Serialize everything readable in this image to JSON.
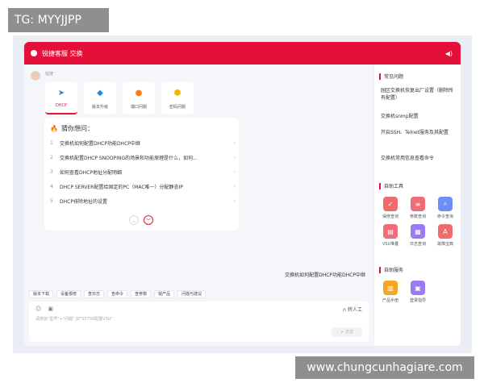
{
  "overlay_tag": "TG: MYYJJPP",
  "watermark": "www.chungcunhagiare.com",
  "titlebar": {
    "title": "锐捷客服 交换"
  },
  "bot": {
    "name": "锐捷"
  },
  "quick_cards": [
    {
      "label": "DHCP",
      "icon": "navigation-icon",
      "color": "#3a7bd5"
    },
    {
      "label": "版本升级",
      "icon": "upgrade-icon",
      "color": "#1e88e5"
    },
    {
      "label": "端口问题",
      "icon": "port-icon",
      "color": "#ff7a1a"
    },
    {
      "label": "密码问题",
      "icon": "password-icon",
      "color": "#f5b400"
    }
  ],
  "guess": {
    "title": "猜你想问：",
    "items": [
      {
        "num": "1",
        "text": "交换机如何配置DHCP功能DHCP中继"
      },
      {
        "num": "2",
        "text": "交换机配置DHCP SNOOPING的场景和功能原理是什么，如何..."
      },
      {
        "num": "3",
        "text": "如何查看DHCP地址分配明细"
      },
      {
        "num": "4",
        "text": "DHCP SERVER配置给固定的PC（MAC唯一）分配静态IP"
      },
      {
        "num": "5",
        "text": "DHCP排除地址的设置"
      }
    ]
  },
  "user_message": "交换机如何配置DHCP功能DHCP中继",
  "quick_buttons": [
    "版本下载",
    "设备报修",
    "查日志",
    "查命令",
    "查参数",
    "锐产品",
    "问题与建议"
  ],
  "input": {
    "placeholder": "请按如\"型号\"+\"问题\",如\"S5750配置VSU\"",
    "human_label": "转人工",
    "send_label": "发送"
  },
  "sidebar": {
    "faq_title": "常见问题",
    "faqs": [
      "园区交换机恢复出厂设置（删除所有配置）",
      "交换机snmp配置",
      "开启SSH、Telnet服务及其配置",
      "交换机常用信息查看命令"
    ],
    "tools_title": "自助工具",
    "tools": [
      {
        "label": "保修查询",
        "color": "#f06b6b"
      },
      {
        "label": "参数查询",
        "color": "#ef6d76"
      },
      {
        "label": "命令查询",
        "color": "#6d8ef5"
      },
      {
        "label": "VSU堆叠",
        "color": "#ef6d76"
      },
      {
        "label": "日志查询",
        "color": "#9b7cf0"
      },
      {
        "label": "故障宝典",
        "color": "#f06b6b"
      }
    ],
    "service_title": "自助服务",
    "services": [
      {
        "label": "产品手册",
        "color": "#f5a623"
      },
      {
        "label": "登录指导",
        "color": "#9b7cf0"
      }
    ]
  }
}
